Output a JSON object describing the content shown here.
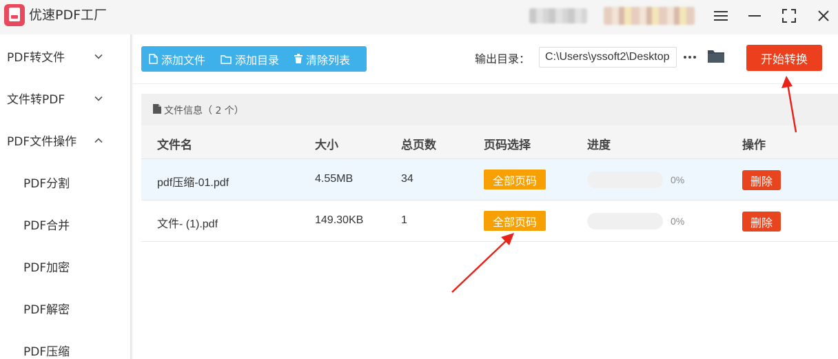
{
  "app": {
    "title": "优速PDF工厂"
  },
  "sidebar": {
    "groups": [
      {
        "label": "PDF转文件"
      },
      {
        "label": "文件转PDF"
      },
      {
        "label": "PDF文件操作"
      }
    ],
    "subitems": [
      {
        "label": "PDF分割"
      },
      {
        "label": "PDF合并"
      },
      {
        "label": "PDF加密"
      },
      {
        "label": "PDF解密"
      },
      {
        "label": "PDF压缩"
      }
    ]
  },
  "toolbar": {
    "add_file": "添加文件",
    "add_dir": "添加目录",
    "clear_list": "清除列表",
    "output_label": "输出目录：",
    "output_path": "C:\\Users\\yssoft2\\Desktop",
    "more": "···",
    "start": "开始转换"
  },
  "panel": {
    "title": "文件信息（ 2 个）"
  },
  "table": {
    "headers": [
      "文件名",
      "大小",
      "总页数",
      "页码选择",
      "进度",
      "操作"
    ],
    "rows": [
      {
        "name": "pdf压缩-01.pdf",
        "size": "4.55MB",
        "pages": "34",
        "page_select": "全部页码",
        "progress": 0,
        "progress_text": "0%",
        "action": "删除"
      },
      {
        "name": "文件- (1).pdf",
        "size": "149.30KB",
        "pages": "1",
        "page_select": "全部页码",
        "progress": 0,
        "progress_text": "0%",
        "action": "删除"
      }
    ]
  },
  "colors": {
    "accent": "#3fb1ea",
    "start": "#eb3f1d",
    "page_btn": "#f7a004",
    "delete": "#e8451e",
    "annotation": "#e8231a"
  }
}
